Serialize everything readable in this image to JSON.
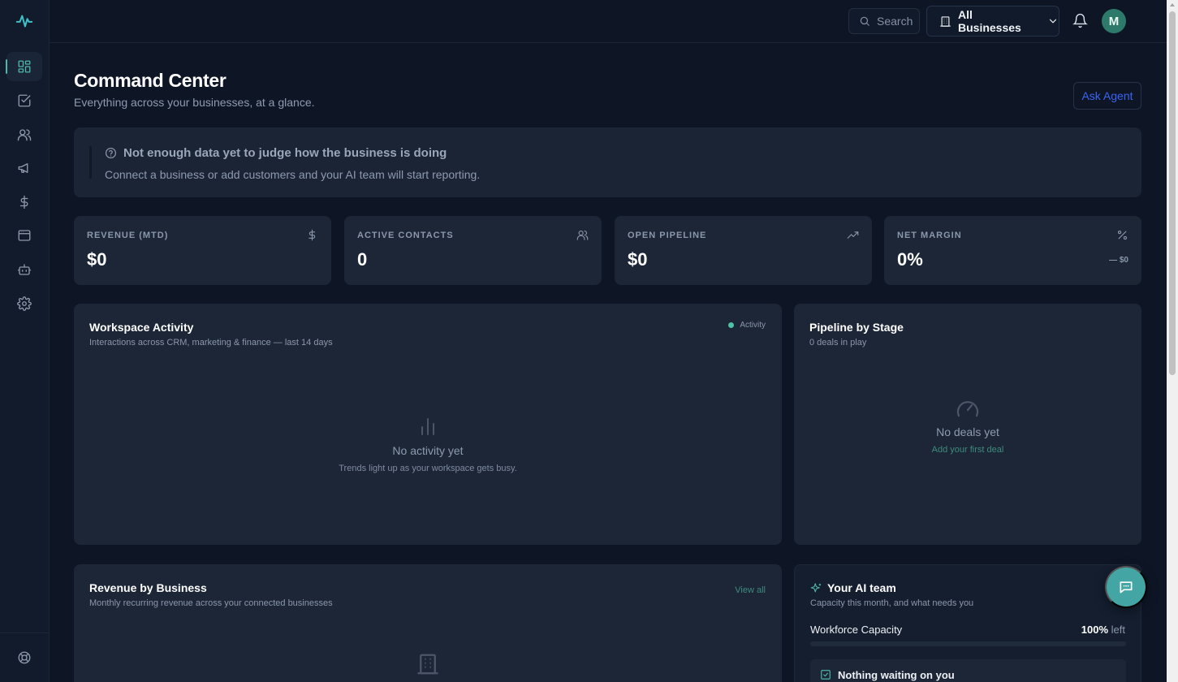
{
  "topbar": {
    "search_label": "Search",
    "business_select": "All Businesses",
    "avatar_initial": "M"
  },
  "sidebar": {
    "items": [
      {
        "icon": "dashboard-icon",
        "active": true
      },
      {
        "icon": "tasks-icon"
      },
      {
        "icon": "contacts-icon"
      },
      {
        "icon": "megaphone-icon"
      },
      {
        "icon": "dollar-icon"
      },
      {
        "icon": "browser-window-icon"
      },
      {
        "icon": "bot-icon"
      },
      {
        "icon": "gear-icon"
      }
    ],
    "bottom_icon": "help-lifebuoy-icon"
  },
  "header": {
    "title": "Command Center",
    "subtitle": "Everything across your businesses, at a glance.",
    "ask_agent": "Ask Agent"
  },
  "notice": {
    "title": "Not enough data yet to judge how the business is doing",
    "text": "Connect a business or add customers and your AI team will start reporting."
  },
  "stats": [
    {
      "label": "REVENUE (MTD)",
      "value": "$0",
      "icon": "dollar-icon"
    },
    {
      "label": "ACTIVE CONTACTS",
      "value": "0",
      "icon": "users-icon"
    },
    {
      "label": "OPEN PIPELINE",
      "value": "$0",
      "icon": "trending-up-icon"
    },
    {
      "label": "NET MARGIN",
      "value": "0%",
      "icon": "percent-icon",
      "foot": "— $0"
    }
  ],
  "activity": {
    "title": "Workspace Activity",
    "subtitle": "Interactions across CRM, marketing & finance — last 14 days",
    "legend": "Activity",
    "legend_color": "#4fc3a6",
    "empty_title": "No activity yet",
    "empty_sub": "Trends light up as your workspace gets busy."
  },
  "pipeline": {
    "title": "Pipeline by Stage",
    "subtitle": "0 deals in play",
    "empty_title": "No deals yet",
    "empty_link": "Add your first deal"
  },
  "revenue": {
    "title": "Revenue by Business",
    "subtitle": "Monthly recurring revenue across your connected businesses",
    "view_all": "View all"
  },
  "ai_team": {
    "title": "Your AI team",
    "subtitle": "Capacity this month, and what needs you",
    "capacity_label": "Workforce Capacity",
    "capacity_value": "100%",
    "capacity_suffix": "left",
    "capacity_fraction": 1.0,
    "nothing_text": "Nothing waiting on you"
  },
  "colors": {
    "accent": "#4fb7a7",
    "link": "#3b63f2",
    "background": "#0e1626",
    "card": "#1c2637"
  }
}
